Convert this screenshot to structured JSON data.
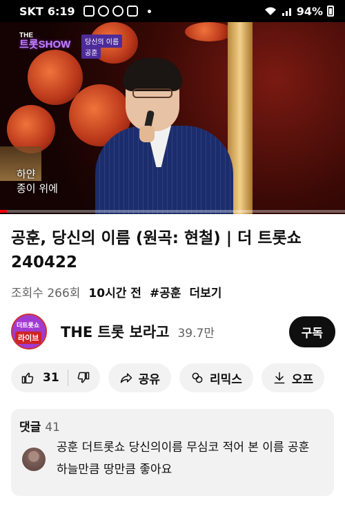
{
  "status": {
    "carrier": "SKT",
    "time": "6:19",
    "battery": "94%"
  },
  "video": {
    "show_logo_top": "THE",
    "show_logo_main": "트롯SHOW",
    "song_tag": "당신의 이름",
    "singer_tag": "공훈",
    "subtitle_line1": "하얀",
    "subtitle_line2": "종이 위에",
    "progress": 0.02
  },
  "title": "공훈, 당신의 이름 (원곡: 현철) | 더 트롯쇼 240422",
  "meta": {
    "views": "조회수 266회",
    "time": "10시간 전",
    "tag": "#공훈",
    "more": "더보기"
  },
  "channel": {
    "avatar_top": "더트롯쇼",
    "avatar_badge": "라이브",
    "name": "THE 트롯 보라고",
    "subscribers": "39.7만",
    "subscribe_label": "구독"
  },
  "actions": {
    "likes": "31",
    "share": "공유",
    "remix": "리믹스",
    "download": "오프"
  },
  "comments": {
    "label": "댓글",
    "count": "41",
    "top_comment": "공훈 더트롯쇼 당신의이름 무심코 적어 본 이름 공훈 하늘만큼 땅만큼 좋아요"
  },
  "colors": {
    "accent": "#ff0000",
    "subscribe_bg": "#0f0f0f",
    "pill_bg": "#f2f2f2"
  }
}
